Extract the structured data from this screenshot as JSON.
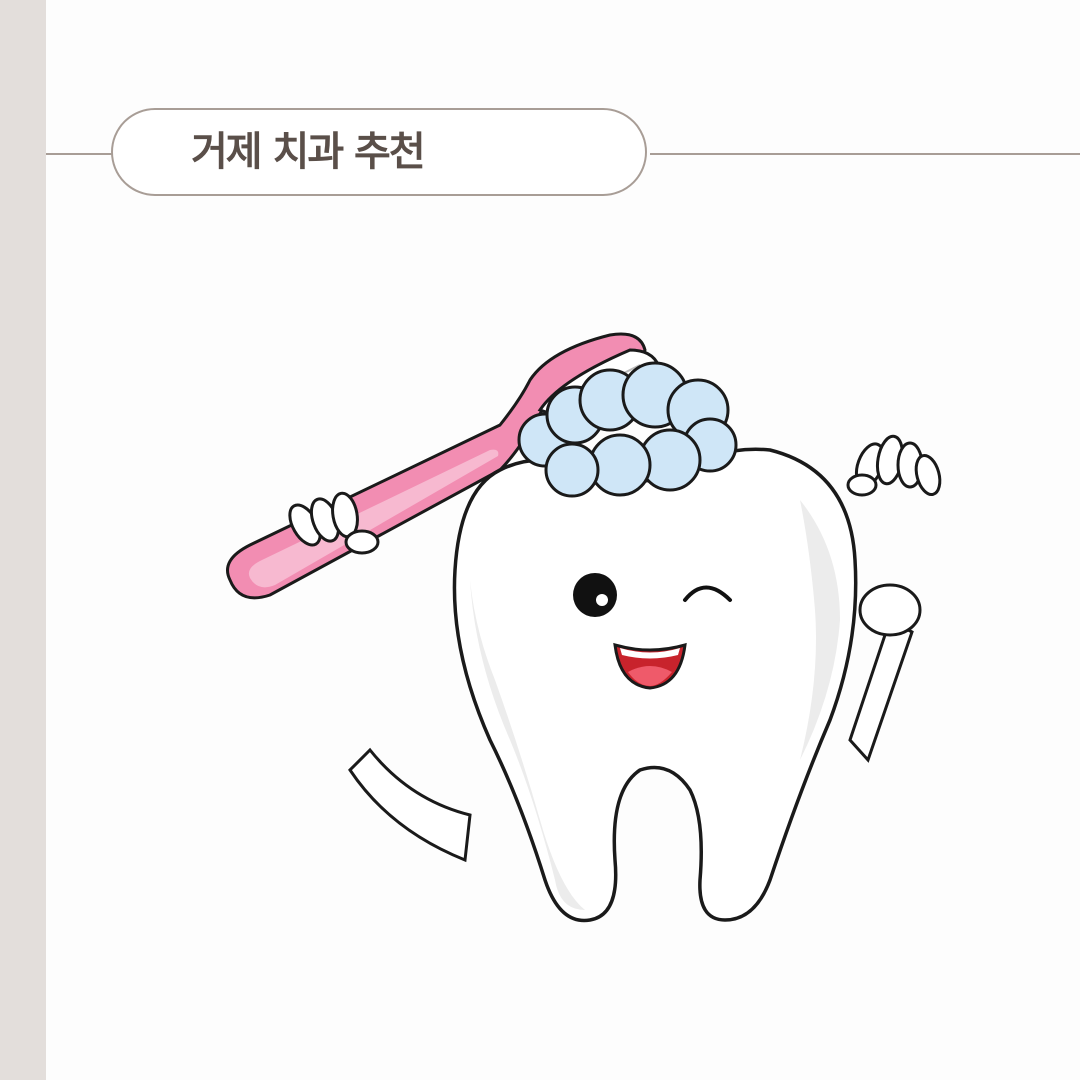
{
  "title": "거제 치과 추천",
  "illustration": {
    "subject": "tooth-mascot-brushing-icon"
  },
  "colors": {
    "side_bar": "#e3dedb",
    "rule": "#a89d96",
    "pill_border": "#a89d96",
    "title_text": "#5a4f49",
    "toothbrush": "#f28db2",
    "toothbrush_light": "#f7b9d0",
    "foam": "#cfe6f7",
    "outline": "#1a1a1a",
    "mouth": "#c8232c",
    "tongue": "#ef5a6a"
  }
}
